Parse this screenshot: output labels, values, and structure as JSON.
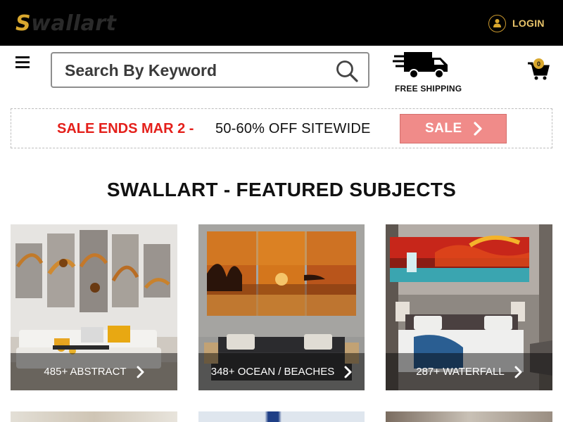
{
  "header": {
    "logo_first": "S",
    "logo_rest": "wallart",
    "login_label": "LOGIN"
  },
  "search": {
    "placeholder": "Search By Keyword"
  },
  "shipping": {
    "label": "FREE SHIPPING"
  },
  "cart": {
    "count": "0"
  },
  "sale": {
    "ends_text": "SALE ENDS MAR 2 -",
    "offer_text": "50-60% OFF SITEWIDE",
    "button_label": "SALE"
  },
  "featured": {
    "title": "SWALLART - FEATURED SUBJECTS",
    "tiles": [
      {
        "label": "485+ ABSTRACT"
      },
      {
        "label": "348+ OCEAN / BEACHES"
      },
      {
        "label": "287+ WATERFALL"
      }
    ]
  },
  "colors": {
    "brand_gold": "#d9a82e",
    "sale_red": "#e4201b",
    "sale_button": "#f08b89",
    "topbar": "#000000"
  },
  "icons": [
    "user-icon",
    "menu-icon",
    "search-icon",
    "truck-icon",
    "cart-icon",
    "chevron-right-icon"
  ]
}
